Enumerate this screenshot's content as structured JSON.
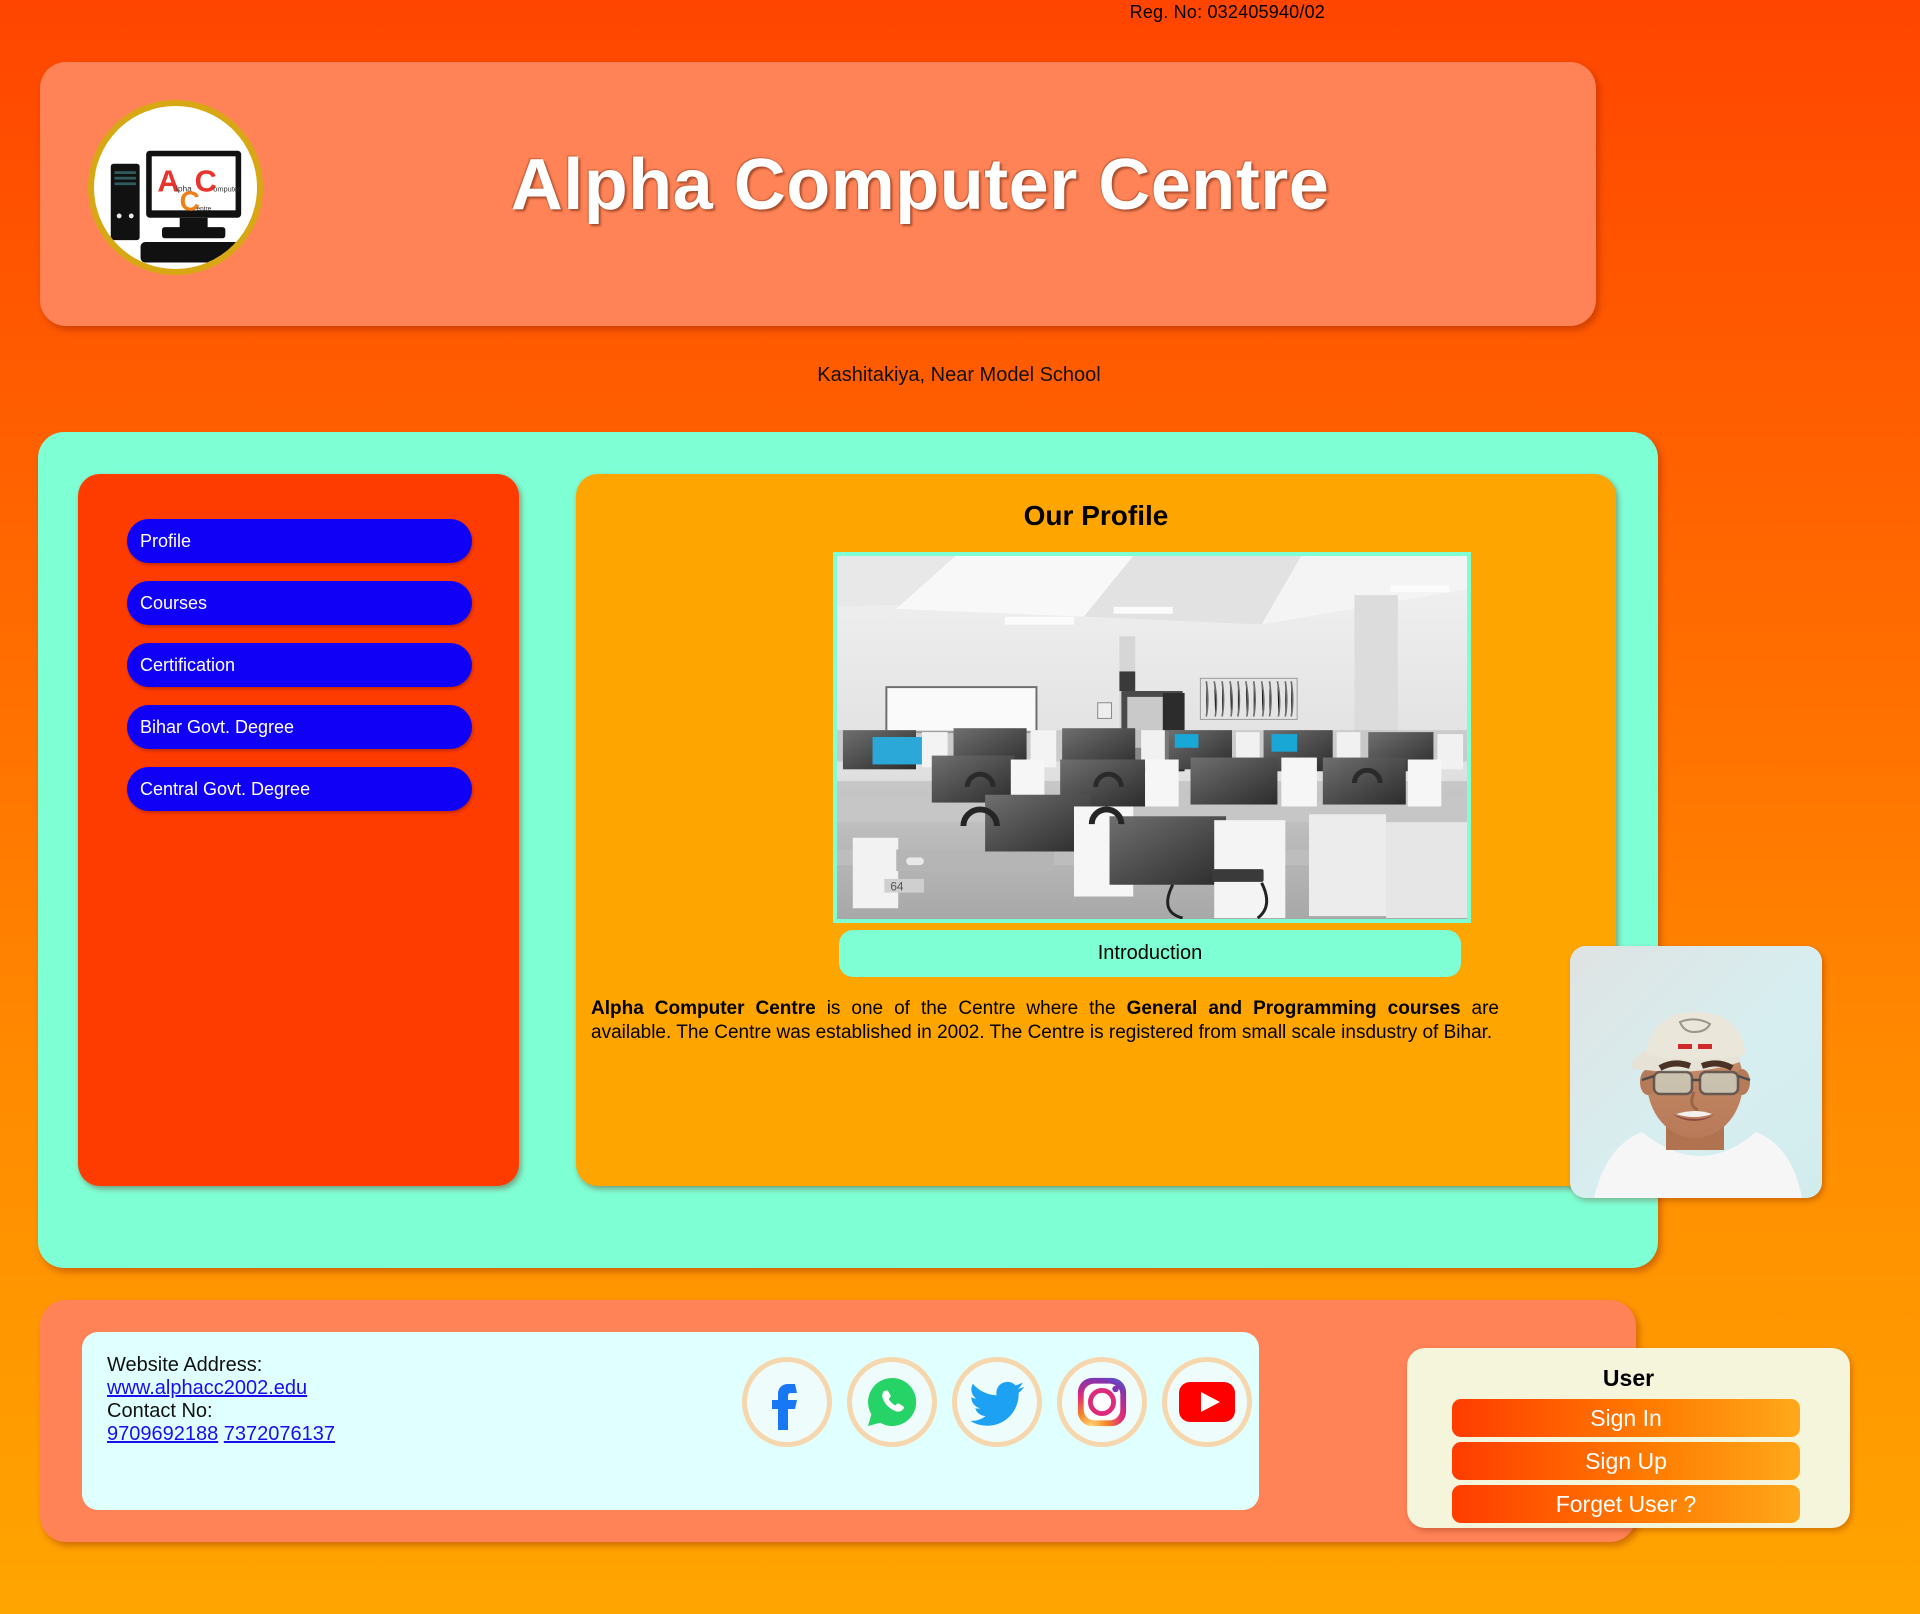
{
  "registration": {
    "label": "Reg. No: 032405940/02"
  },
  "header": {
    "title": "Alpha Computer Centre",
    "logo": {
      "letter_a": "A",
      "letter_c1": "C",
      "letter_c2": "C",
      "sub_alpha": "lpha",
      "sub_computer": "omputer",
      "sub_centre": "entre"
    }
  },
  "address": {
    "text": "Kashitakiya, Near Model School"
  },
  "sidebar": {
    "items": [
      {
        "label": "Profile"
      },
      {
        "label": "Courses"
      },
      {
        "label": "Certification"
      },
      {
        "label": "Bihar Govt. Degree"
      },
      {
        "label": "Central Govt. Degree"
      }
    ]
  },
  "content": {
    "title": "Our Profile",
    "image_caption": "computer-lab-photo",
    "intro_button": "Introduction",
    "paragraph": {
      "bold1": "Alpha Computer Centre",
      "text1": " is one of the Centre where the ",
      "bold2": "General and Programming courses",
      "text2": " are available. The Centre was established in 2002. The Centre is registered from small scale insdustry of Bihar."
    }
  },
  "footer": {
    "website_label": "Website Address:",
    "website_url": "www.alphacc2002.edu",
    "contact_label": "Contact No:",
    "phone1": "9709692188",
    "phone2": "7372076137",
    "social": [
      {
        "name": "facebook-icon"
      },
      {
        "name": "whatsapp-icon"
      },
      {
        "name": "twitter-icon"
      },
      {
        "name": "instagram-icon"
      },
      {
        "name": "youtube-icon"
      }
    ]
  },
  "user_panel": {
    "title": "User",
    "sign_in": "Sign In",
    "sign_up": "Sign Up",
    "forget_user": "Forget User ?"
  },
  "colors": {
    "page_top": "#FF4500",
    "page_bottom": "#FFA500",
    "header_panel": "#FF8356",
    "mint": "#7FFFD4",
    "sidebar": "#FF3C00",
    "nav_button": "#1100F6",
    "content_panel": "#FFA500",
    "footer_info": "#E0FFFF",
    "user_panel": "#F5F5DC",
    "link": "#1A0DEE"
  }
}
